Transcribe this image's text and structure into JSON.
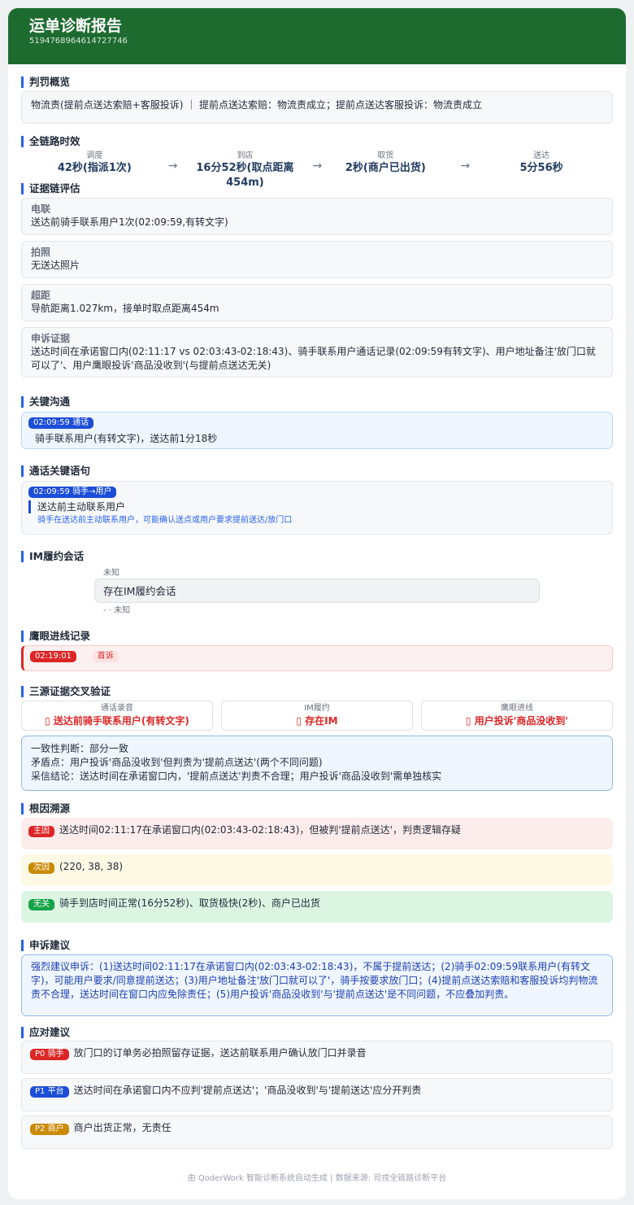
{
  "header": {
    "title": "运单诊断报告",
    "order_id": "5194768964614727746"
  },
  "sections": {
    "penalty": "判罚概览",
    "timeline": "全链路时效",
    "evidence": "证据链评估",
    "comm": "关键沟通",
    "quotes": "通话关键语句",
    "im": "IM履约会话",
    "eagle": "鹰眼进线记录",
    "cross": "三源证据交叉验证",
    "root": "根因溯源",
    "appeal": "申诉建议",
    "actions": "应对建议"
  },
  "penalty": {
    "text": "物流责(提前点送达索赔+客服投诉) ｜ 提前点送达索赔：物流责成立；提前点送达客服投诉：物流责成立"
  },
  "timeline": {
    "steps": [
      {
        "label": "调度",
        "value": "42秒(指派1次)"
      },
      {
        "label": "到店",
        "value": "16分52秒(取点距离454m)"
      },
      {
        "label": "取货",
        "value": "2秒(商户已出货)"
      },
      {
        "label": "送达",
        "value": "5分56秒"
      }
    ],
    "arrow": "→"
  },
  "evidence": [
    {
      "title": "电联",
      "desc": "送达前骑手联系用户1次(02:09:59,有转文字)"
    },
    {
      "title": "拍照",
      "desc": "无送达照片"
    },
    {
      "title": "超距",
      "desc": "导航距离1.027km，接单时取点距离454m"
    },
    {
      "title": "申诉证据",
      "desc": "送达时间在承诺窗口内(02:11:17 vs 02:03:43-02:18:43)、骑手联系用户通话记录(02:09:59有转文字)、用户地址备注'放门口就可以了'、用户鹰眼投诉'商品没收到'(与提前点送达无关)"
    }
  ],
  "comm": {
    "tag": "02:09:59  通话",
    "text": "骑手联系用户(有转文字)，送达前1分18秒"
  },
  "quote": {
    "tag": "02:09:59  骑手→用户",
    "text": "送达前主动联系用户",
    "note": "骑手在送达前主动联系用户，可能确认送点或用户要求提前送达/放门口"
  },
  "im": {
    "top": "未知",
    "bubble": "存在IM履约会话",
    "bottom": "-  · 未知"
  },
  "eagle": {
    "time": "02:19:01",
    "type": "首诉"
  },
  "cross": {
    "items": [
      {
        "label": "通话录音",
        "value": "▯ 送达前骑手联系用户(有转文字)"
      },
      {
        "label": "IM履约",
        "value": "▯ 存在IM"
      },
      {
        "label": "鹰眼进线",
        "value": "▯ 用户投诉'商品没收到'"
      }
    ],
    "l1": "一致性判断：部分一致",
    "l2": "矛盾点：用户投诉'商品没收到'但判责为'提前点送达'(两个不同问题)",
    "l3": "采信结论：送达时间在承诺窗口内，'提前点送达'判责不合理；用户投诉'商品没收到'需单独核实"
  },
  "root": [
    {
      "tag": "主因",
      "text": "送达时间02:11:17在承诺窗口内(02:03:43-02:18:43)，但被判'提前点送达'，判责逻辑存疑",
      "bg": "#fdecec",
      "tagcolor": "#dc2626"
    },
    {
      "tag": "次因",
      "text": "(220, 38, 38)",
      "bg": "#fef9e5",
      "tagcolor": "#ca8a04"
    },
    {
      "tag": "无关",
      "text": "骑手到店时间正常(16分52秒)、取货极快(2秒)、商户已出货",
      "bg": "#dcf5e3",
      "tagcolor": "#16a34a"
    }
  ],
  "appeal": {
    "text": "强烈建议申诉：(1)送达时间02:11:17在承诺窗口内(02:03:43-02:18:43)，不属于提前送达；(2)骑手02:09:59联系用户(有转文字)，可能用户要求/同意提前送达；(3)用户地址备注'放门口就可以了'，骑手按要求放门口；(4)提前点送达索赔和客服投诉均判物流责不合理，送达时间在窗口内应免除责任；(5)用户投诉'商品没收到'与'提前点送达'是不同问题，不应叠加判责。"
  },
  "actions": [
    {
      "tag": "P0 骑手",
      "text": "放门口的订单务必拍照留存证据，送达前联系用户确认放门口并录音",
      "color": "#dc2626"
    },
    {
      "tag": "P1 平台",
      "text": "送达时间在承诺窗口内不应判'提前点送达'；'商品没收到'与'提前送达'应分开判责",
      "color": "#1d4ed8"
    },
    {
      "tag": "P2 商户",
      "text": "商户出货正常，无责任",
      "color": "#ca8a04"
    }
  ],
  "footer": "由 QoderWork 智能诊断系统自动生成 | 数据来源: 司戎全链路诊断平台"
}
